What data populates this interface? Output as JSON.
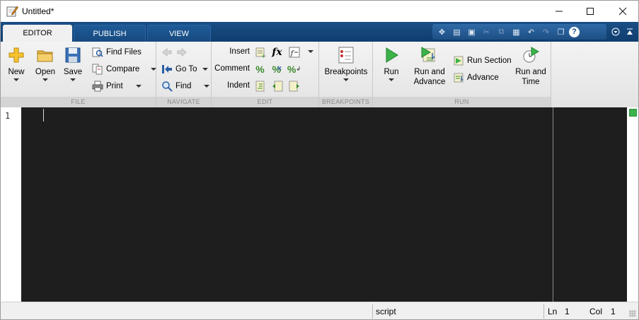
{
  "window": {
    "title": "Untitled*"
  },
  "tabs": [
    {
      "label": "EDITOR",
      "active": true
    },
    {
      "label": "PUBLISH",
      "active": false
    },
    {
      "label": "VIEW",
      "active": false
    }
  ],
  "ribbon": {
    "file": {
      "label": "FILE",
      "new": "New",
      "open": "Open",
      "save": "Save",
      "find_files": "Find Files",
      "compare": "Compare",
      "print": "Print"
    },
    "navigate": {
      "label": "NAVIGATE",
      "go_to": "Go To",
      "find": "Find"
    },
    "edit": {
      "label": "EDIT",
      "insert": "Insert",
      "comment": "Comment",
      "indent": "Indent",
      "fx": "fx"
    },
    "breakpoints": {
      "label": "BREAKPOINTS",
      "breakpoints": "Breakpoints"
    },
    "run": {
      "label": "RUN",
      "run": "Run",
      "run_and_advance_1": "Run and",
      "run_and_advance_2": "Advance",
      "run_section": "Run Section",
      "advance": "Advance",
      "run_and_time_1": "Run and",
      "run_and_time_2": "Time"
    }
  },
  "editor": {
    "line_numbers": [
      "1"
    ]
  },
  "statusbar": {
    "mode": "script",
    "ln_label": "Ln",
    "ln_value": "1",
    "col_label": "Col",
    "col_value": "1"
  },
  "colors": {
    "tab_strip": "#0f3d6e",
    "editor_bg": "#1e1e1e",
    "run_green": "#3cb34a"
  }
}
